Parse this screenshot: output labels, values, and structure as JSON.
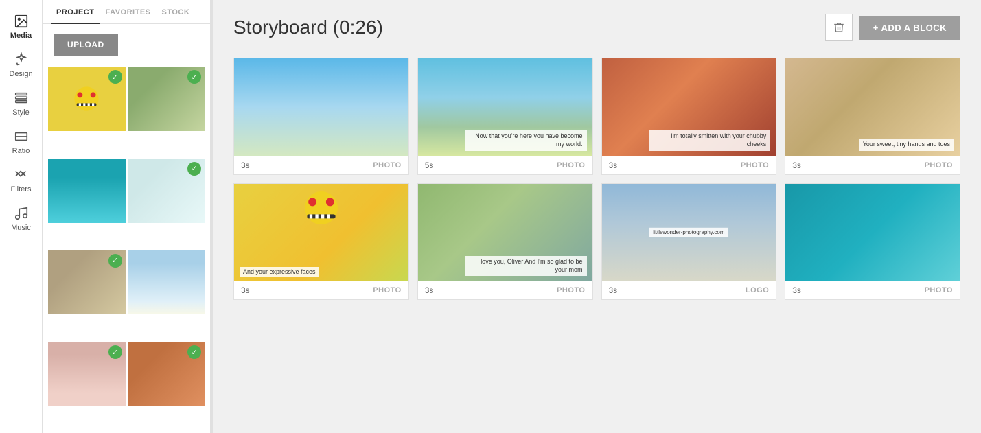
{
  "iconSidebar": {
    "items": [
      {
        "id": "media",
        "label": "Media",
        "active": true
      },
      {
        "id": "design",
        "label": "Design"
      },
      {
        "id": "style",
        "label": "Style"
      },
      {
        "id": "ratio",
        "label": "Ratio"
      },
      {
        "id": "filters",
        "label": "Filters"
      },
      {
        "id": "music",
        "label": "Music"
      }
    ]
  },
  "leftPanel": {
    "tabs": [
      {
        "id": "project",
        "label": "PROJECT",
        "active": true
      },
      {
        "id": "favorites",
        "label": "FAVORITES"
      },
      {
        "id": "stock",
        "label": "STOCK"
      }
    ],
    "uploadLabel": "UPLOAD",
    "thumbs": [
      {
        "id": "thumb-emoji",
        "hasCheck": true,
        "css": "thumb-emoji"
      },
      {
        "id": "thumb-elephant",
        "hasCheck": true,
        "css": "thumb-elephant"
      },
      {
        "id": "thumb-wave1",
        "hasCheck": false,
        "css": "thumb-wave1"
      },
      {
        "id": "thumb-whitesand",
        "hasCheck": true,
        "css": "thumb-whitesand"
      },
      {
        "id": "thumb-statue",
        "hasCheck": true,
        "css": "thumb-statue"
      },
      {
        "id": "thumb-beach",
        "hasCheck": false,
        "css": "thumb-beach"
      },
      {
        "id": "thumb-pink",
        "hasCheck": true,
        "css": "thumb-pink"
      },
      {
        "id": "thumb-redrock",
        "hasCheck": true,
        "css": "thumb-redrock"
      }
    ]
  },
  "storyboard": {
    "title": "Storyboard (0:26)",
    "deleteLabel": "",
    "addBlockLabel": "+ ADD A BLOCK",
    "rows": [
      [
        {
          "duration": "3s",
          "type": "PHOTO",
          "css": "card-sky",
          "overlayText": "",
          "overlayPos": ""
        },
        {
          "duration": "5s",
          "type": "PHOTO",
          "css": "card-coast",
          "overlayText": "Now that you're here\nyou have become my world.",
          "overlayPos": "bottom-right"
        },
        {
          "duration": "3s",
          "type": "PHOTO",
          "css": "card-canyon",
          "overlayText": "i'm totally smitten\nwith your chubby cheeks",
          "overlayPos": "bottom-right"
        },
        {
          "duration": "3s",
          "type": "PHOTO",
          "css": "card-desert",
          "overlayText": "Your sweet, tiny\nhands and toes",
          "overlayPos": "bottom-right"
        }
      ],
      [
        {
          "duration": "3s",
          "type": "PHOTO",
          "css": "card-emoji-big",
          "overlayText": "And your expressive faces",
          "overlayPos": "bottom-right"
        },
        {
          "duration": "3s",
          "type": "PHOTO",
          "css": "card-elephant2",
          "overlayText": "love you, Oliver\nAnd I'm so glad to be your mom",
          "overlayPos": "bottom-right"
        },
        {
          "duration": "3s",
          "type": "LOGO",
          "css": "card-statue2",
          "overlayText": "littlewonder-photography.com",
          "overlayPos": "center"
        },
        {
          "duration": "3s",
          "type": "PHOTO",
          "css": "card-wave2",
          "overlayText": "",
          "overlayPos": ""
        }
      ]
    ]
  }
}
